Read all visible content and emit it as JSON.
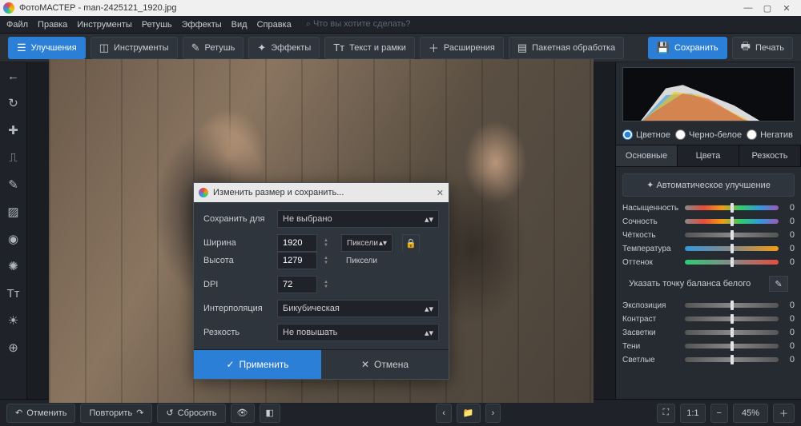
{
  "title": "ФотоМАСТЕР - man-2425121_1920.jpg",
  "menu": [
    "Файл",
    "Правка",
    "Инструменты",
    "Ретушь",
    "Эффекты",
    "Вид",
    "Справка"
  ],
  "search_placeholder": "Что вы хотите сделать?",
  "tabs": {
    "enhance": "Улучшения",
    "tools": "Инструменты",
    "retouch": "Ретушь",
    "effects": "Эффекты",
    "text": "Текст и рамки",
    "extensions": "Расширения",
    "batch": "Пакетная обработка",
    "save": "Сохранить",
    "print": "Печать"
  },
  "radios": {
    "color": "Цветное",
    "bw": "Черно-белое",
    "neg": "Негатив"
  },
  "rtabs": {
    "basic": "Основные",
    "colors": "Цвета",
    "sharp": "Резкость"
  },
  "autofix": "Автоматическое улучшение",
  "sliders": {
    "saturation": {
      "label": "Насыщенность",
      "val": "0"
    },
    "vibrance": {
      "label": "Сочность",
      "val": "0"
    },
    "clarity": {
      "label": "Чёткость",
      "val": "0"
    },
    "temperature": {
      "label": "Температура",
      "val": "0"
    },
    "tint": {
      "label": "Оттенок",
      "val": "0"
    },
    "wb": "Указать точку баланса белого",
    "exposure": {
      "label": "Экспозиция",
      "val": "0"
    },
    "contrast": {
      "label": "Контраст",
      "val": "0"
    },
    "highlights": {
      "label": "Засветки",
      "val": "0"
    },
    "shadows": {
      "label": "Тени",
      "val": "0"
    },
    "whites": {
      "label": "Светлые",
      "val": "0"
    }
  },
  "bottom": {
    "undo": "Отменить",
    "redo": "Повторить",
    "reset": "Сбросить",
    "zoom": "45%",
    "ratio": "1:1"
  },
  "dialog": {
    "title": "Изменить размер и сохранить...",
    "save_for": "Сохранить для",
    "save_for_val": "Не выбрано",
    "width": "Ширина",
    "width_val": "1920",
    "height": "Высота",
    "height_val": "1279",
    "unit": "Пиксели",
    "dpi": "DPI",
    "dpi_val": "72",
    "interp": "Интерполяция",
    "interp_val": "Бикубическая",
    "sharp": "Резкость",
    "sharp_val": "Не повышать",
    "apply": "Применить",
    "cancel": "Отмена"
  }
}
